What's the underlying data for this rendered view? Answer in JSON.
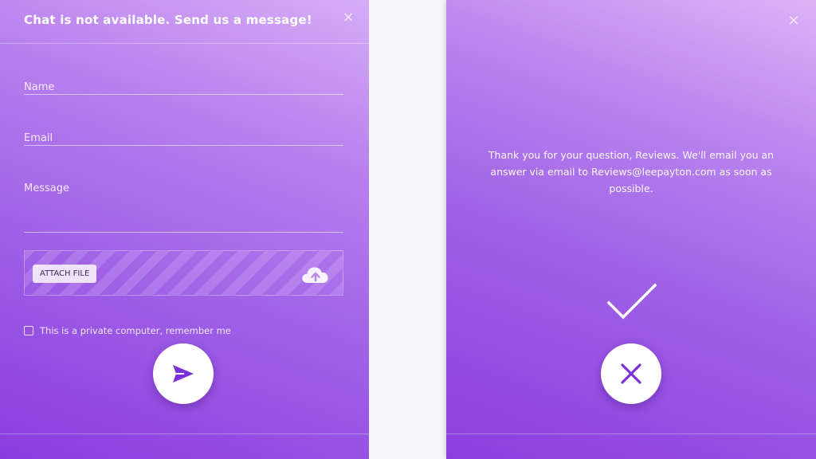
{
  "left_form": {
    "header_title": "Chat is not available. Send us a message!",
    "close_symbol": "×",
    "name_field": {
      "placeholder": "Name",
      "value": ""
    },
    "email_field": {
      "placeholder": "Email",
      "value": ""
    },
    "message_field": {
      "label": "Message",
      "value": ""
    },
    "attach_button_label": "ATTACH FILE",
    "upload_icon": "cloud-upload-icon",
    "remember_label": "This is a private computer, remember me",
    "remember_checked": false,
    "send_icon": "send-icon"
  },
  "right_confirmation": {
    "close_symbol": "×",
    "message": "Thank you for your question, Reviews. We'll email you an answer via email to Reviews@leepayton.com as soon as possible.",
    "check_icon": "checkmark-icon",
    "dismiss_icon": "close-icon"
  },
  "colors": {
    "gradient_light": "#d6adf6",
    "gradient_dark": "#8a3ddf",
    "accent_purple": "#7b2fd6",
    "button_bg": "#ffffff"
  }
}
